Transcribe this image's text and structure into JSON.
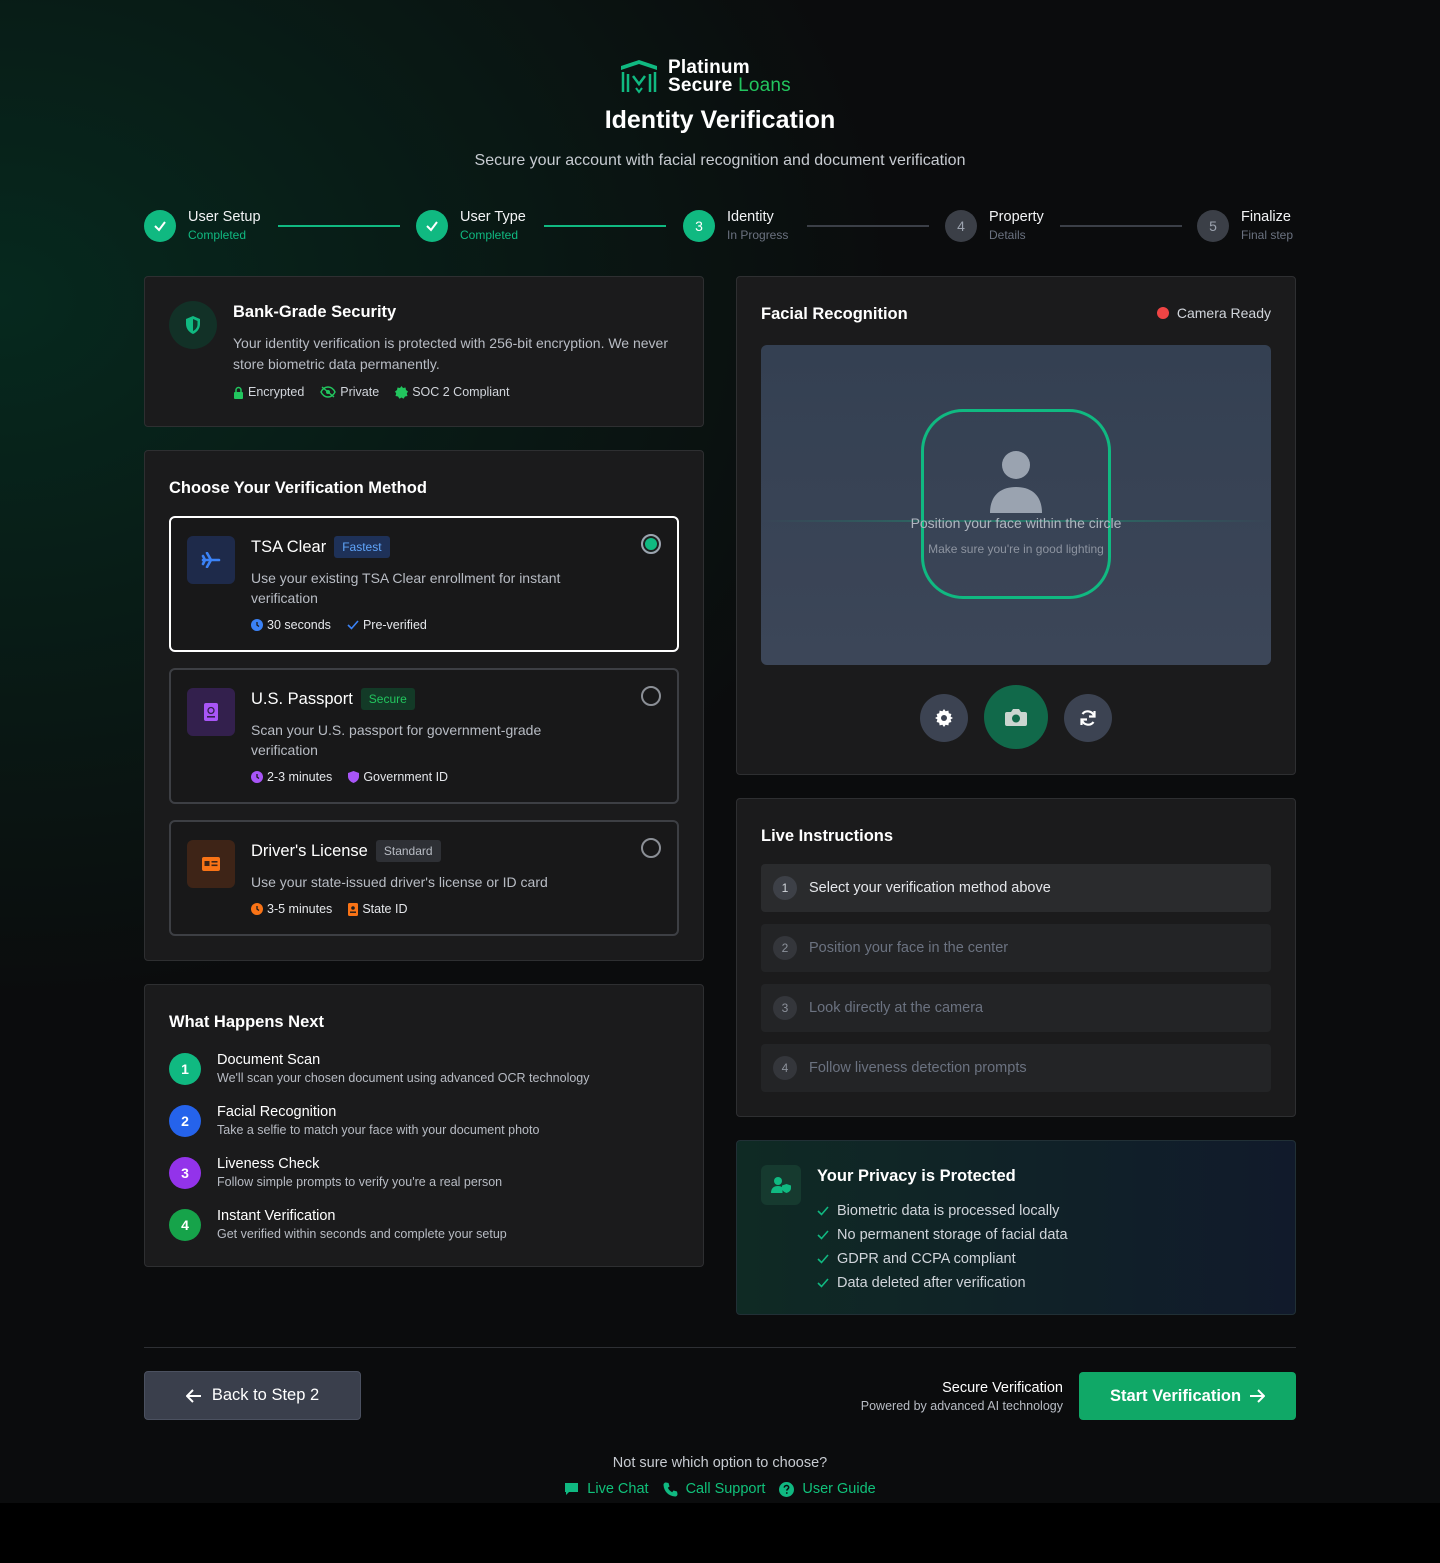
{
  "brand": {
    "line1": "Platinum",
    "line2_a": "Secure",
    "line2_b": "Loans"
  },
  "header": {
    "title": "Identity Verification",
    "subtitle": "Secure your account with facial recognition and document verification"
  },
  "steps": [
    {
      "num": "1",
      "title": "User Setup",
      "status": "Completed"
    },
    {
      "num": "2",
      "title": "User Type",
      "status": "Completed"
    },
    {
      "num": "3",
      "title": "Identity",
      "status": "In Progress"
    },
    {
      "num": "4",
      "title": "Property",
      "status": "Details"
    },
    {
      "num": "5",
      "title": "Finalize",
      "status": "Final step"
    }
  ],
  "security": {
    "title": "Bank-Grade Security",
    "description": "Your identity verification is protected with 256-bit encryption. We never store biometric data permanently.",
    "tags": [
      "Encrypted",
      "Private",
      "SOC 2 Compliant"
    ]
  },
  "methods": {
    "title": "Choose Your Verification Method",
    "items": [
      {
        "name": "TSA Clear",
        "badge": "Fastest",
        "description": "Use your existing TSA Clear enrollment for instant verification",
        "time": "30 seconds",
        "extra": "Pre-verified"
      },
      {
        "name": "U.S. Passport",
        "badge": "Secure",
        "description": "Scan your U.S. passport for government-grade verification",
        "time": "2-3 minutes",
        "extra": "Government ID"
      },
      {
        "name": "Driver's License",
        "badge": "Standard",
        "description": "Use your state-issued driver's license or ID card",
        "time": "3-5 minutes",
        "extra": "State ID"
      }
    ]
  },
  "next": {
    "title": "What Happens Next",
    "items": [
      {
        "num": "1",
        "title": "Document Scan",
        "desc": "We'll scan your chosen document using advanced OCR technology"
      },
      {
        "num": "2",
        "title": "Facial Recognition",
        "desc": "Take a selfie to match your face with your document photo"
      },
      {
        "num": "3",
        "title": "Liveness Check",
        "desc": "Follow simple prompts to verify you're a real person"
      },
      {
        "num": "4",
        "title": "Instant Verification",
        "desc": "Get verified within seconds and complete your setup"
      }
    ]
  },
  "facial": {
    "title": "Facial Recognition",
    "status": "Camera Ready",
    "hint": "Position your face within the circle",
    "subhint": "Make sure you're in good lighting"
  },
  "instructions": {
    "title": "Live Instructions",
    "items": [
      {
        "num": "1",
        "text": "Select your verification method above"
      },
      {
        "num": "2",
        "text": "Position your face in the center"
      },
      {
        "num": "3",
        "text": "Look directly at the camera"
      },
      {
        "num": "4",
        "text": "Follow liveness detection prompts"
      }
    ]
  },
  "privacy": {
    "title": "Your Privacy is Protected",
    "items": [
      "Biometric data is processed locally",
      "No permanent storage of facial data",
      "GDPR and CCPA compliant",
      "Data deleted after verification"
    ]
  },
  "footer": {
    "back_label": "Back to Step 2",
    "secure_title": "Secure Verification",
    "secure_sub": "Powered by advanced AI technology",
    "start_label": "Start Verification",
    "help_question": "Not sure which option to choose?",
    "links": [
      "Live Chat",
      "Call Support",
      "User Guide"
    ]
  },
  "colors": {
    "accent": "#10b981",
    "background": "#0b0c0d",
    "card": "#1b1b1c",
    "camera_status": "#ef4444"
  }
}
